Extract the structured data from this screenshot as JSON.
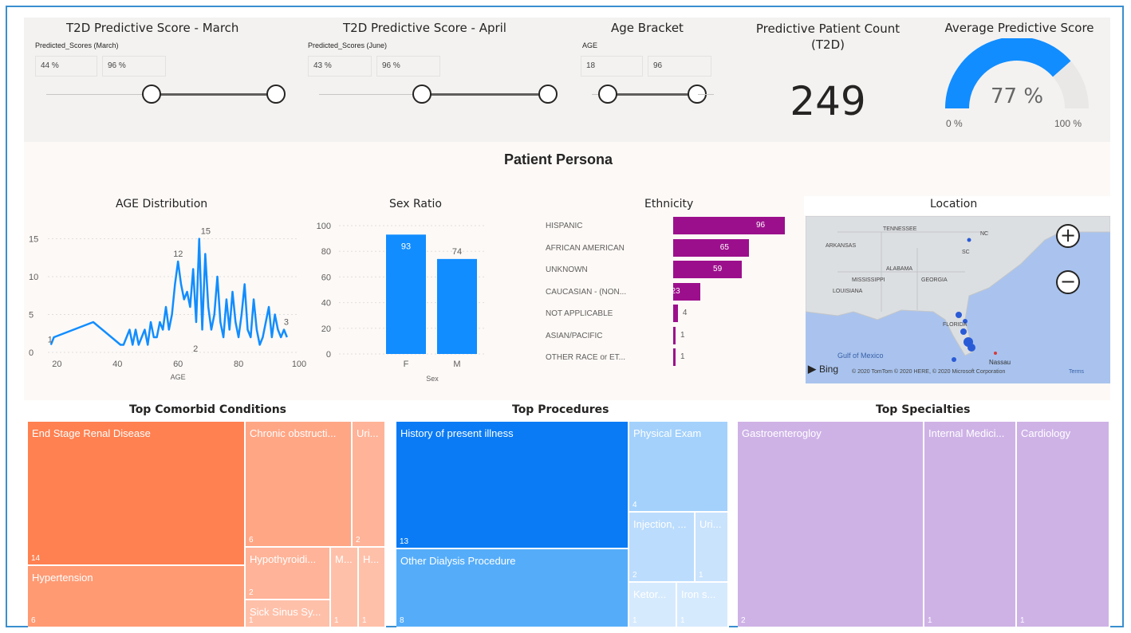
{
  "slicers": [
    {
      "title": "T2D Predictive Score - March",
      "field": "Predicted_Scores (March)",
      "min": "44 %",
      "max": "96 %"
    },
    {
      "title": "T2D Predictive Score - April",
      "field": "Predicted_Scores (June)",
      "min": "43 %",
      "max": "96 %"
    },
    {
      "title": "Age Bracket",
      "field": "AGE",
      "min": "18",
      "max": "96"
    }
  ],
  "count_card": {
    "title": "Predictive Patient Count (T2D)",
    "value": "249"
  },
  "gauge_card": {
    "title": "Average Predictive Score",
    "value": "77 %",
    "min_label": "0 %",
    "max_label": "100 %",
    "fraction": 0.77,
    "color": "#118dff"
  },
  "persona": {
    "title": "Patient Persona"
  },
  "age_chart": {
    "title": "AGE Distribution",
    "chart_data": {
      "type": "line",
      "xlabel": "AGE",
      "xlim": [
        17,
        100
      ],
      "ylim": [
        0,
        16
      ],
      "x_ticks": [
        "20",
        "40",
        "60",
        "80",
        "100"
      ],
      "y_ticks": [
        "0",
        "5",
        "10",
        "15"
      ],
      "data_labels": [
        "1",
        "12",
        "15",
        "2",
        "3"
      ],
      "color": "#118dff",
      "series": [
        {
          "x": [
            18,
            19,
            32,
            41,
            42,
            44,
            45,
            46,
            47,
            48,
            49,
            50,
            51,
            52,
            53,
            54,
            55,
            56,
            57,
            58,
            59,
            60,
            61,
            62,
            63,
            64,
            65,
            66,
            67,
            68,
            69,
            70,
            71,
            72,
            73,
            74,
            75,
            76,
            77,
            78,
            79,
            80,
            81,
            82,
            83,
            84,
            85,
            86,
            87,
            88,
            89,
            90,
            91,
            92,
            93,
            94,
            95,
            96
          ],
          "y": [
            1,
            2,
            4,
            1,
            1,
            3,
            1,
            3,
            1,
            2,
            3,
            1,
            4,
            2,
            2,
            4,
            3,
            6,
            3,
            5,
            9,
            12,
            9,
            7,
            8,
            6,
            11,
            4,
            15,
            3,
            13,
            6,
            3,
            5,
            10,
            4,
            2,
            7,
            3,
            8,
            4,
            2,
            5,
            9,
            3,
            2,
            7,
            3,
            1,
            2,
            4,
            6,
            2,
            5,
            3,
            2,
            3,
            2
          ]
        }
      ]
    }
  },
  "sex_chart": {
    "title": "Sex Ratio",
    "chart_data": {
      "type": "bar",
      "xlabel": "Sex",
      "categories": [
        "F",
        "M"
      ],
      "values": [
        93,
        74
      ],
      "ylim": [
        0,
        100
      ],
      "y_ticks": [
        "0",
        "20",
        "40",
        "60",
        "80",
        "100"
      ],
      "color": "#118dff"
    }
  },
  "ethnicity_chart": {
    "title": "Ethnicity",
    "chart_data": {
      "type": "bar",
      "orientation": "horizontal",
      "categories": [
        "HISPANIC",
        "AFRICAN AMERICAN",
        "UNKNOWN",
        "CAUCASIAN - (NON...",
        "NOT APPLICABLE",
        "ASIAN/PACIFIC",
        "OTHER RACE or ET..."
      ],
      "values": [
        96,
        65,
        59,
        23,
        4,
        1,
        1
      ],
      "color": "#9c0f8c"
    }
  },
  "location_map": {
    "title": "Location",
    "labels": [
      "TENNESSEE",
      "NC",
      "ARKANSAS",
      "SC",
      "ALABAMA",
      "MISSISSIPPI",
      "GEORGIA",
      "LOUISIANA",
      "FLORIDA",
      "Gulf of Mexico",
      "Nassau"
    ],
    "zoom_in": "+",
    "zoom_out": "−",
    "bing": "Bing",
    "attribution": "© 2020 TomTom © 2020 HERE, © 2020 Microsoft Corporation",
    "terms": "Terms"
  },
  "comorbid": {
    "title": "Top Comorbid Conditions",
    "color": "#ff8050",
    "tiles": [
      {
        "label": "End Stage Renal Disease",
        "value": "14"
      },
      {
        "label": "Hypertension",
        "value": "6"
      },
      {
        "label": "Chronic obstructi...",
        "value": "6"
      },
      {
        "label": "Uri...",
        "value": "2"
      },
      {
        "label": "Hypothyroidi...",
        "value": "2"
      },
      {
        "label": "M...",
        "value": "1"
      },
      {
        "label": "H...",
        "value": "1"
      },
      {
        "label": "Sick Sinus Sy...",
        "value": "1"
      }
    ]
  },
  "procedures": {
    "title": "Top Procedures",
    "color": "#118dff",
    "tiles": [
      {
        "label": "History of present illness",
        "value": "13"
      },
      {
        "label": "Other Dialysis Procedure",
        "value": "8"
      },
      {
        "label": "Physical Exam",
        "value": "4"
      },
      {
        "label": "Injection, ...",
        "value": "2"
      },
      {
        "label": "Uri...",
        "value": "1"
      },
      {
        "label": "Ketor...",
        "value": "1"
      },
      {
        "label": "Iron s...",
        "value": "1"
      }
    ]
  },
  "specialties": {
    "title": "Top Specialties",
    "color": "#ceb2e6",
    "tiles": [
      {
        "label": "Gastroenterogloy",
        "value": "2"
      },
      {
        "label": "Internal Medici...",
        "value": "1"
      },
      {
        "label": "Cardiology",
        "value": "1"
      }
    ]
  }
}
